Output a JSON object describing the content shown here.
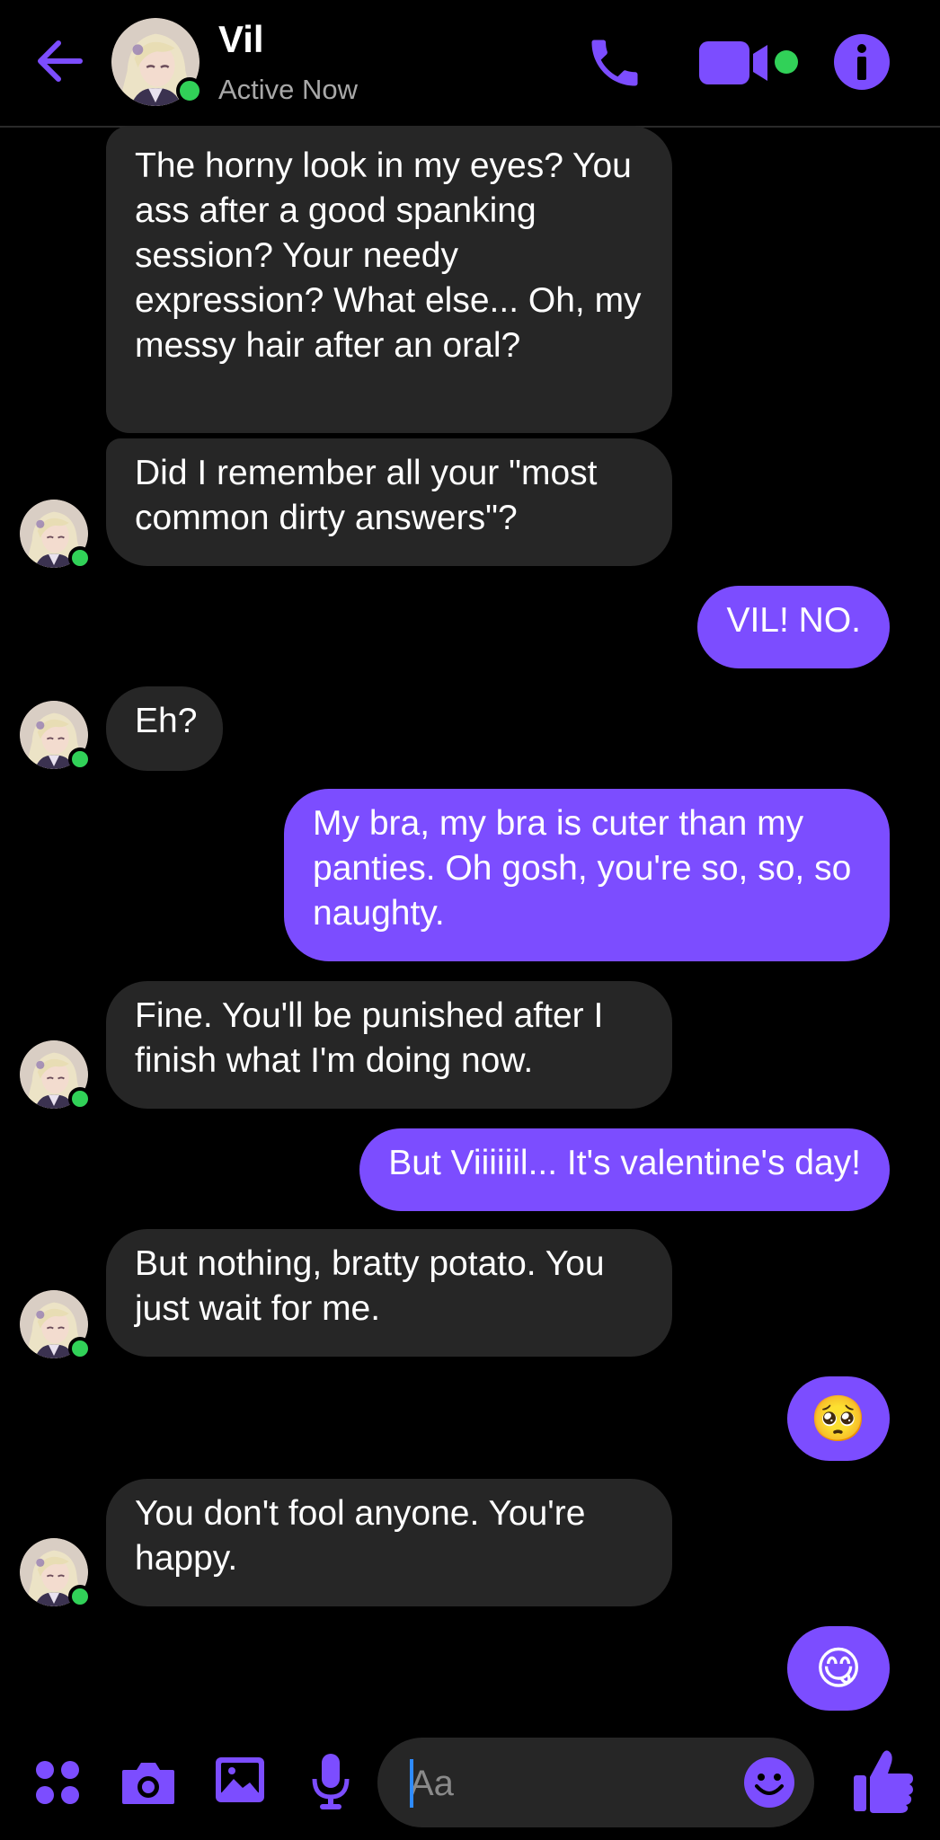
{
  "header": {
    "contact_name": "Vil",
    "status": "Active Now",
    "icons": [
      "back-arrow-icon",
      "phone-icon",
      "video-camera-icon",
      "info-icon"
    ]
  },
  "messages": [
    {
      "from": "contact",
      "text": "The horny look in my eyes? You ass after a good spanking session? Your needy expression? What else... Oh, my messy hair after an oral?"
    },
    {
      "from": "contact",
      "text": "Did I remember all your \"most common dirty answers\"?"
    },
    {
      "from": "me",
      "text": "VIL! NO."
    },
    {
      "from": "contact",
      "text": "Eh?"
    },
    {
      "from": "me",
      "text": "My bra, my bra is cuter than my panties. Oh gosh, you're so, so, so naughty."
    },
    {
      "from": "contact",
      "text": "Fine. You'll be punished after I finish what I'm doing now."
    },
    {
      "from": "me",
      "text": "But Viiiiiil... It's valentine's day!"
    },
    {
      "from": "contact",
      "text": "But nothing, bratty potato. You just wait for me."
    },
    {
      "from": "me",
      "text": "🥺"
    },
    {
      "from": "contact",
      "text": "You don't fool anyone. You're happy."
    },
    {
      "from": "me",
      "text": "😋"
    }
  ],
  "composer": {
    "placeholder": "Aa",
    "value": "",
    "icons": [
      "grid-icon",
      "camera-icon",
      "gallery-icon",
      "microphone-icon",
      "emoji-icon",
      "thumbs-up-icon"
    ]
  },
  "colors": {
    "accent": "#7c4dff",
    "incoming_bubble": "#262626",
    "background": "#000000",
    "online": "#31d158"
  }
}
